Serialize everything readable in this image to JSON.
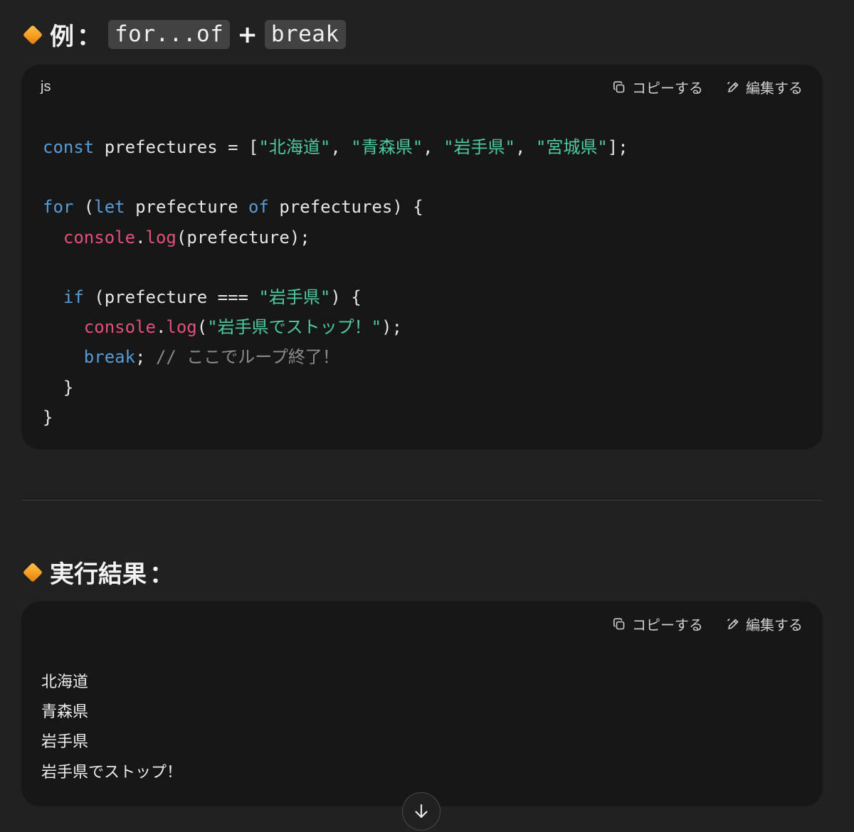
{
  "section1": {
    "title_prefix": "例",
    "colon": "：",
    "code_a": "for...of",
    "plus": "+",
    "code_b": "break"
  },
  "code_block": {
    "language": "js",
    "copy_label": "コピーする",
    "edit_label": "編集する",
    "tokens": {
      "const": "const",
      "decl": " prefectures = [",
      "s1": "\"北海道\"",
      "sep": ", ",
      "s2": "\"青森県\"",
      "s3": "\"岩手県\"",
      "s4": "\"宮城県\"",
      "decl_end": "];",
      "for": "for",
      "paren_open": " (",
      "let": "let",
      "var": " prefecture ",
      "of": "of",
      "loop_end": " prefectures) {",
      "console": "console",
      "dot": ".",
      "log": "log",
      "log_arg": "(prefecture);",
      "if": "if",
      "cond": " (prefecture === ",
      "cond_str": "\"岩手県\"",
      "cond_end": ") {",
      "paren": "(",
      "stop_str": "\"岩手県でストップ！\"",
      "call_end": ");",
      "break": "break",
      "semi": "; ",
      "comment": "// ここでループ終了！",
      "close_brace": "}"
    }
  },
  "section2": {
    "title": "実行結果",
    "colon": "："
  },
  "output_block": {
    "copy_label": "コピーする",
    "edit_label": "編集する",
    "lines": [
      "北海道",
      "青森県",
      "岩手県",
      "岩手県でストップ！"
    ]
  },
  "icons": {
    "copy": "copy-icon",
    "edit": "pencil-icon",
    "scroll": "arrow-down-icon"
  }
}
